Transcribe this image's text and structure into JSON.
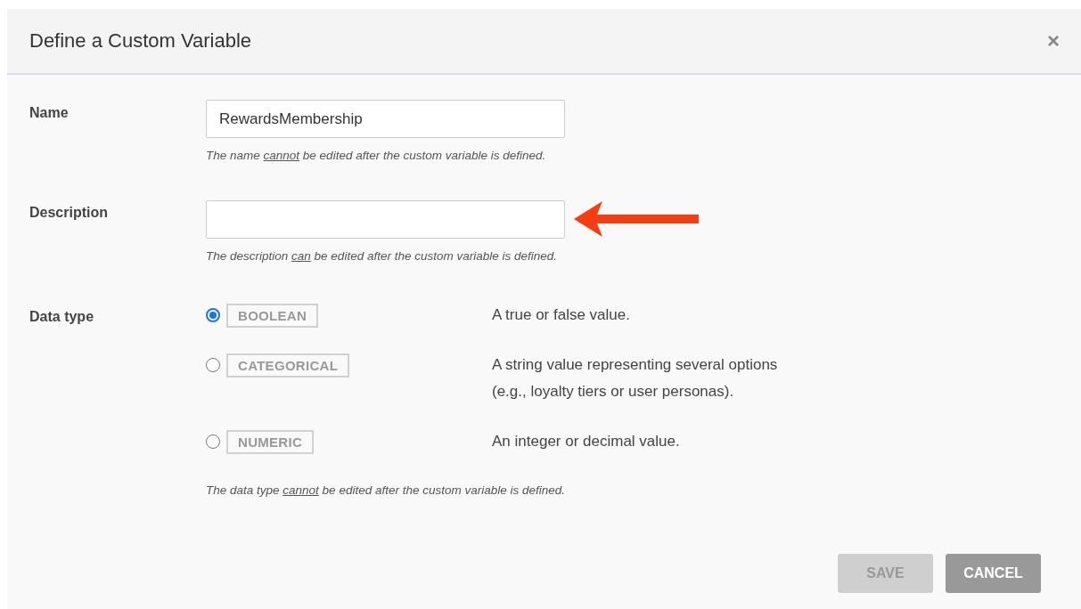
{
  "dialog": {
    "title": "Define a Custom Variable",
    "close": "×"
  },
  "fields": [
    {
      "label": "Name",
      "value": "RewardsMembership",
      "hint": {
        "before": "The name ",
        "underlined": "cannot",
        "after": " be edited after the custom variable is defined."
      },
      "annotated": false
    },
    {
      "label": "Description",
      "hint": {
        "before": "The description ",
        "underlined": "can",
        "after": " be edited after the custom variable is defined."
      },
      "annotated": true
    }
  ],
  "data_type": {
    "label": "Data type",
    "options": [
      {
        "tag": "BOOLEAN",
        "description": [
          "A true or false value."
        ],
        "selected": true
      },
      {
        "tag": "CATEGORICAL",
        "description": [
          "A string value representing several options",
          "(e.g., loyalty tiers or user personas)."
        ],
        "selected": false
      },
      {
        "tag": "NUMERIC",
        "description": [
          "An integer or decimal value."
        ],
        "selected": false
      }
    ],
    "hint": {
      "before": "The data type ",
      "underlined": "cannot",
      "after": " be edited after the custom variable is defined."
    }
  },
  "buttons": [
    {
      "label": "SAVE",
      "disabled": true
    },
    {
      "label": "CANCEL",
      "disabled": false
    }
  ]
}
